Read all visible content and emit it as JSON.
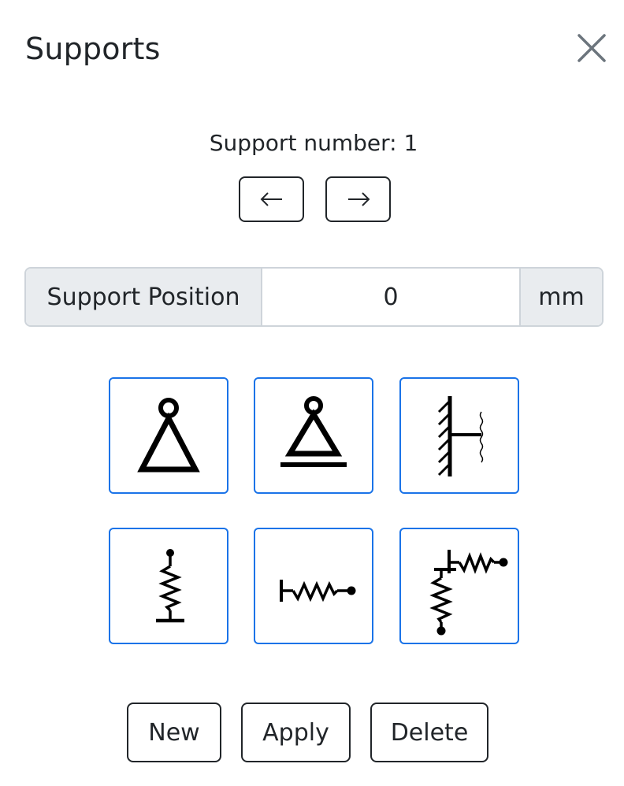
{
  "dialog": {
    "title": "Supports"
  },
  "navigator": {
    "support_number_text": "Support number: 1",
    "prev_symbol": "←",
    "next_symbol": "→"
  },
  "position_field": {
    "label": "Support Position",
    "value": "0",
    "unit": "mm"
  },
  "support_types": [
    {
      "icon": "pinned-support-icon"
    },
    {
      "icon": "roller-support-icon"
    },
    {
      "icon": "fixed-support-icon"
    },
    {
      "icon": "vertical-spring-support-icon"
    },
    {
      "icon": "horizontal-spring-support-icon"
    },
    {
      "icon": "rotational-spring-support-icon"
    }
  ],
  "actions": {
    "new_label": "New",
    "apply_label": "Apply",
    "delete_label": "Delete"
  },
  "colors": {
    "accent_border": "#1a73e8",
    "addon_background": "#e9ecef",
    "text": "#212529"
  }
}
